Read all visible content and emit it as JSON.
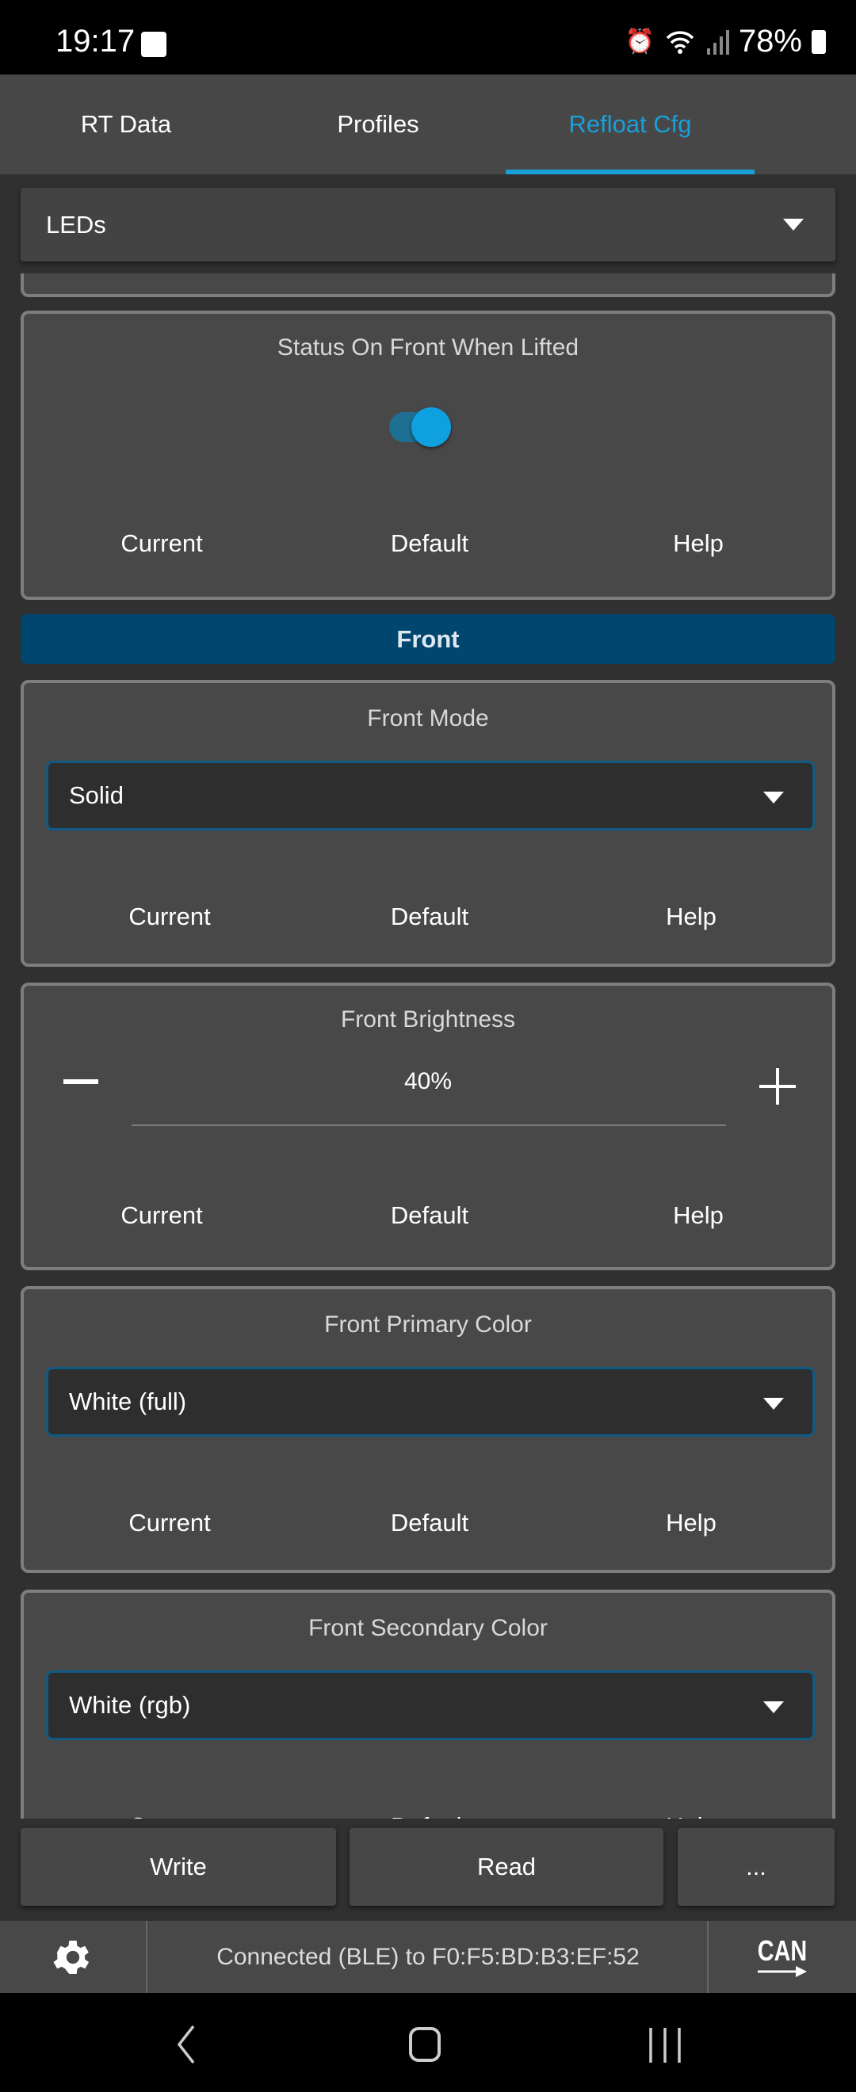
{
  "status_bar": {
    "time": "19:17",
    "battery": "78%",
    "icons": [
      "gallery-icon",
      "alarm-icon",
      "wifi-icon",
      "signal-icon",
      "battery-icon"
    ]
  },
  "tabs": [
    {
      "label": "RT Data",
      "active": false
    },
    {
      "label": "Profiles",
      "active": false
    },
    {
      "label": "Refloat Cfg",
      "active": true
    }
  ],
  "category": {
    "value": "LEDs"
  },
  "cards": {
    "status_front": {
      "title": "Status On Front When Lifted",
      "toggle_on": true,
      "current": "Current",
      "default": "Default",
      "help": "Help"
    },
    "section": "Front",
    "front_mode": {
      "title": "Front Mode",
      "value": "Solid",
      "current": "Current",
      "default": "Default",
      "help": "Help"
    },
    "front_brightness": {
      "title": "Front Brightness",
      "value": "40%",
      "minus": "−",
      "plus": "+",
      "current": "Current",
      "default": "Default",
      "help": "Help"
    },
    "front_primary": {
      "title": "Front Primary Color",
      "value": "White (full)",
      "current": "Current",
      "default": "Default",
      "help": "Help"
    },
    "front_secondary": {
      "title": "Front Secondary Color",
      "value": "White (rgb)",
      "current": "Current",
      "default": "Default",
      "help": "Help"
    }
  },
  "actions": {
    "write": "Write",
    "read": "Read",
    "more": "..."
  },
  "connection": {
    "text": "Connected (BLE) to F0:F5:BD:B3:EF:52",
    "can_label": "CAN"
  },
  "colors": {
    "accent": "#1a9fd9",
    "section_header": "#00466e",
    "background": "#303030",
    "card": "#484848"
  }
}
